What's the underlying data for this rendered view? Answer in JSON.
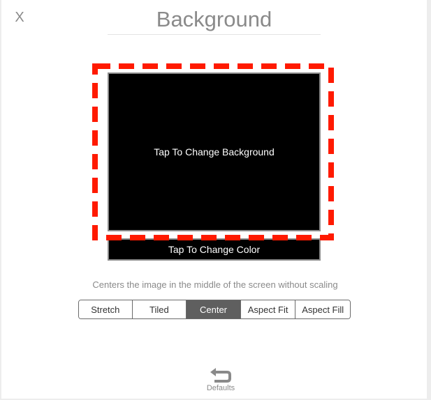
{
  "header": {
    "close_label": "X",
    "title": "Background"
  },
  "preview": {
    "label": "Tap To Change Background",
    "background_color": "#000000"
  },
  "color_bar": {
    "label": "Tap To Change Color"
  },
  "description": "Centers the image in the middle of the screen without scaling",
  "modes": {
    "options": [
      "Stretch",
      "Tiled",
      "Center",
      "Aspect Fit",
      "Aspect Fill"
    ],
    "selected": "Center"
  },
  "footer": {
    "defaults_label": "Defaults",
    "defaults_icon": "undo-arrow-icon"
  },
  "colors": {
    "highlight": "#ff1a00",
    "selected_segment": "#5f5f5f"
  }
}
